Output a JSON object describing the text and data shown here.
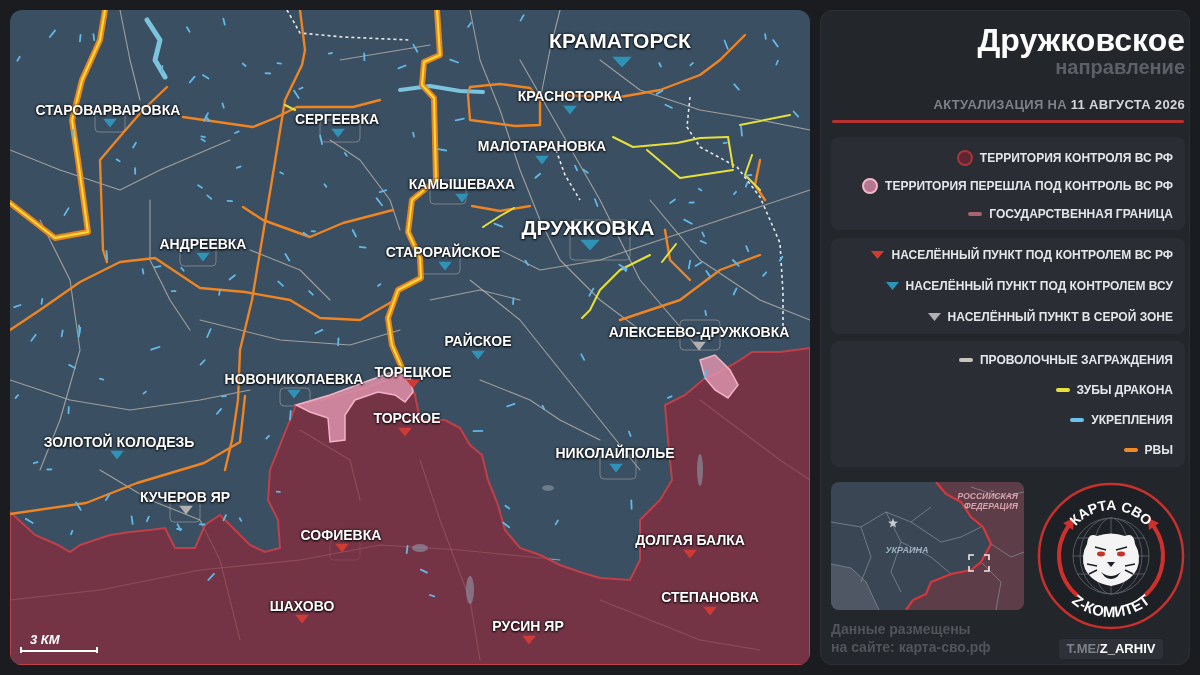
{
  "map": {
    "towns": [
      {
        "name": "КРАМАТОРСК",
        "color": "#2f93b8",
        "major": true
      },
      {
        "name": "КРАСНОТОРКА",
        "color": "#2f93b8",
        "major": false
      },
      {
        "name": "СТАРОВАРВАРОВКА",
        "color": "#2f93b8",
        "major": false
      },
      {
        "name": "СЕРГЕЕВКА",
        "color": "#2f93b8",
        "major": false
      },
      {
        "name": "МАЛОТАРАНОВКА",
        "color": "#2f93b8",
        "major": false
      },
      {
        "name": "КАМЫШЕВАХА",
        "color": "#2f93b8",
        "major": false
      },
      {
        "name": "ДРУЖКОВКА",
        "color": "#2f93b8",
        "major": true
      },
      {
        "name": "АНДРЕЕВКА",
        "color": "#2f93b8",
        "major": false
      },
      {
        "name": "СТАРОРАЙСКОЕ",
        "color": "#2f93b8",
        "major": false
      },
      {
        "name": "РАЙСКОЕ",
        "color": "#2f93b8",
        "major": false
      },
      {
        "name": "АЛЕКСЕЕВО-ДРУЖКОВКА",
        "color": "#b0b0b0",
        "major": false
      },
      {
        "name": "ТОРЕЦКОЕ",
        "color": "#d03a34",
        "major": false
      },
      {
        "name": "НОВОНИКОЛАЕВКА",
        "color": "#2f93b8",
        "major": false
      },
      {
        "name": "ТОРСКОЕ",
        "color": "#d03a34",
        "major": false
      },
      {
        "name": "ЗОЛОТОЙ КОЛОДЕЗЬ",
        "color": "#2f93b8",
        "major": false
      },
      {
        "name": "НИКОЛАЙПОЛЬЕ",
        "color": "#2f93b8",
        "major": false
      },
      {
        "name": "КУЧЕРОВ ЯР",
        "color": "#b0b0b0",
        "major": false
      },
      {
        "name": "СОФИЕВКА",
        "color": "#d03a34",
        "major": false
      },
      {
        "name": "ДОЛГАЯ БАЛКА",
        "color": "#d03a34",
        "major": false
      },
      {
        "name": "СТЕПАНОВКА",
        "color": "#d03a34",
        "major": false
      },
      {
        "name": "ШАХОВО",
        "color": "#d03a34",
        "major": false
      },
      {
        "name": "РУСИН ЯР",
        "color": "#d03a34",
        "major": false
      }
    ],
    "scale_bar": {
      "label": "3 КМ"
    }
  },
  "header": {
    "title": "Дружковское",
    "subtitle": "направление",
    "updated": "АКТУАЛИЗАЦИЯ НА **11 АВГУСТА 2026**"
  },
  "legend": [
    {
      "items": [
        {
          "kind": "area_ru",
          "label": "ТЕРРИТОРИЯ КОНТРОЛЯ ВС РФ"
        },
        {
          "kind": "area_captured",
          "label": "ТЕРРИТОРИЯ ПЕРЕШЛА ПОД КОНТРОЛЬ ВС РФ"
        },
        {
          "kind": "border",
          "label": "ГОСУДАРСТВЕННАЯ ГРАНИЦА"
        }
      ]
    },
    {
      "items": [
        {
          "kind": "town_ru",
          "label": "НАСЕЛЁННЫЙ ПУНКТ ПОД КОНТРОЛЕМ ВС РФ"
        },
        {
          "kind": "town_ua",
          "label": "НАСЕЛЁННЫЙ ПУНКТ ПОД КОНТРОЛЕМ ВСУ"
        },
        {
          "kind": "town_grey",
          "label": "НАСЕЛЁННЫЙ ПУНКТ В СЕРОЙ ЗОНЕ"
        }
      ]
    },
    {
      "items": [
        {
          "kind": "wire",
          "label": "ПРОВОЛОЧНЫЕ ЗАГРАЖДЕНИЯ"
        },
        {
          "kind": "dragon_teeth",
          "label": "ЗУБЫ ДРАКОНА"
        },
        {
          "kind": "fortification",
          "label": "УКРЕПЛЕНИЯ"
        },
        {
          "kind": "ditch",
          "label": "РВЫ"
        }
      ]
    }
  ],
  "inset_map": {
    "labels": [
      "РОССИЙСКАЯ ФЕДЕРАЦИЯ",
      "УКРАИНА"
    ]
  },
  "source_note": "Данные размещены\nна сайте: карта-сво.рф",
  "emblem": {
    "top_text": "КАРТА СВО",
    "bottom_text": "Z-КОМИТЕТ"
  },
  "channel_link": "T.ME/**Z_ARHIV**"
}
